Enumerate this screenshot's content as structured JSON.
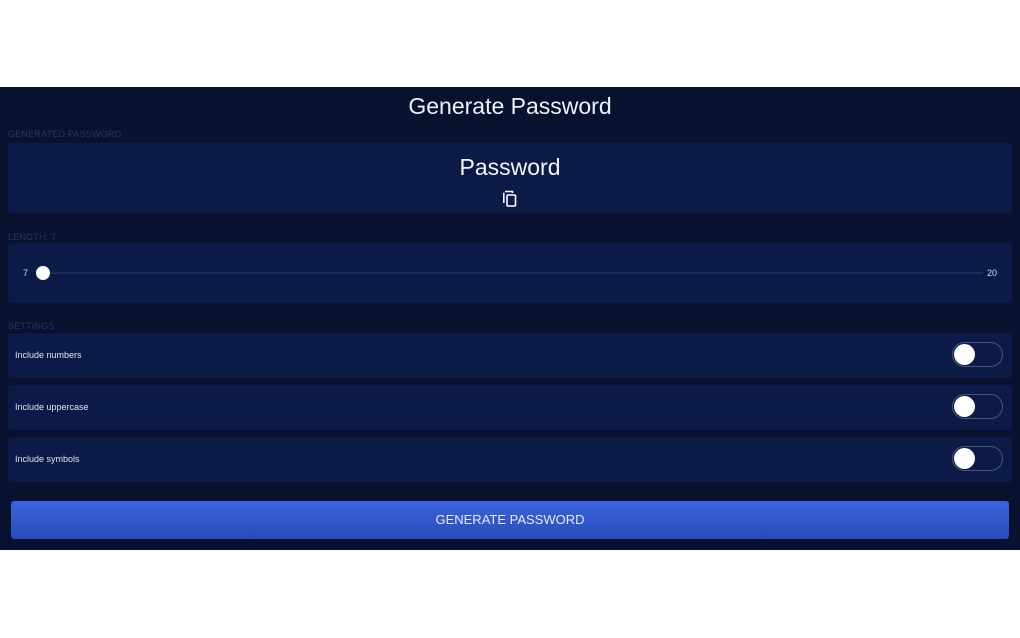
{
  "app": {
    "title": "Generate Password"
  },
  "generated": {
    "section_label": "GENERATED PASSWORD",
    "password": "Password",
    "copy_icon": "copy-icon"
  },
  "length": {
    "section_label": "LENGTH: 7",
    "min": "7",
    "max": "20",
    "value": 7
  },
  "settings": {
    "section_label": "SETTINGS",
    "items": [
      {
        "label": "Include numbers",
        "checked": false
      },
      {
        "label": "Include uppercase",
        "checked": false
      },
      {
        "label": "Include symbols",
        "checked": false
      }
    ]
  },
  "generate_button": {
    "label": "GENERATE PASSWORD"
  },
  "colors": {
    "background": "#08122f",
    "card": "#0b1a47",
    "accent": "#3b64dc"
  }
}
